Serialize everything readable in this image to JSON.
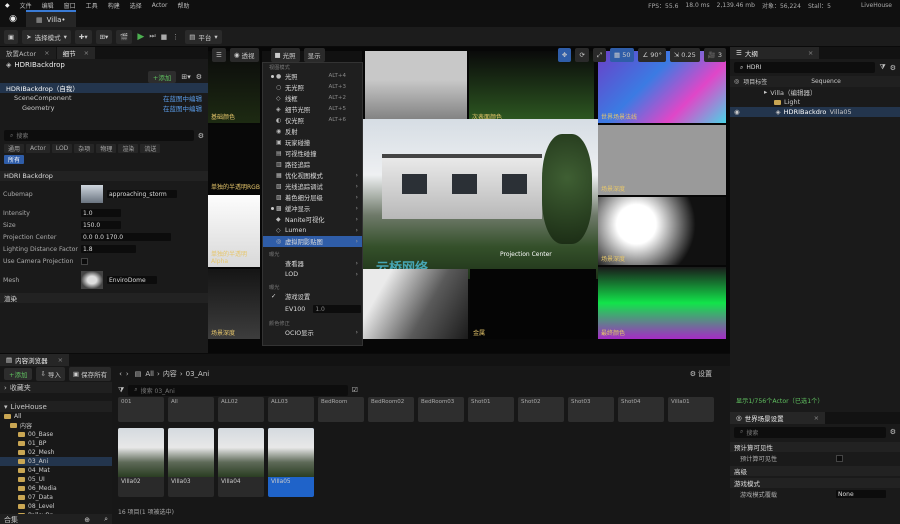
{
  "menubar": {
    "items": [
      "文件",
      "编辑",
      "窗口",
      "工具",
      "构建",
      "选择",
      "Actor",
      "帮助"
    ]
  },
  "stats": {
    "fps": "FPS：55.6",
    "ms": "18.0 ms",
    "mem": "2,139.46 mb",
    "objs": "对象：56,224",
    "stalls": "Stall：5",
    "project": "LiveHouse"
  },
  "tabs": {
    "doc": "Villa•"
  },
  "toolbar": {
    "mode": "选择模式",
    "platform": "平台"
  },
  "left_panel": {
    "tab_place": "放置Actor",
    "tab_details": "细节",
    "actor_name": "HDRIBackdrop",
    "add_label": "+添加",
    "tree": [
      {
        "label": "HDRIBackdrop（自我）",
        "link": ""
      },
      {
        "label": "SceneComponent",
        "link": "在蓝图中编辑"
      },
      {
        "label": "Geometry",
        "link": "在蓝图中编辑"
      }
    ],
    "search_placeholder": "搜索",
    "filters": [
      "通用",
      "Actor",
      "LOD",
      "杂项",
      "物理",
      "渲染",
      "流送"
    ],
    "filter_all": "所有",
    "section": "HDRI Backdrop",
    "props": [
      {
        "label": "Cubemap",
        "value": "approaching_storm"
      },
      {
        "label": "Intensity",
        "value": "1.0"
      },
      {
        "label": "Size",
        "value": "150.0"
      },
      {
        "label": "Projection Center",
        "value": "0.0    0.0    170.0"
      },
      {
        "label": "Lighting Distance Factor",
        "value": "1.8"
      },
      {
        "label": "Use Camera Projection",
        "value": ""
      },
      {
        "label": "Mesh",
        "value": "EnviroDome"
      }
    ],
    "bottom_section": "渲染"
  },
  "viewport": {
    "btn_perspective": "透视",
    "btn_lit": "光照",
    "btn_show": "显示",
    "fov": "90°",
    "speed": "0.25",
    "grid": "50",
    "cam": "3",
    "tiles": [
      "基础颜色",
      "",
      "",
      "次表面颜色",
      "世界场景法线",
      "单独的半透明RGB",
      "",
      "场景深度",
      "单独的半透明Alpha",
      "",
      "",
      "自定义深度",
      "场景深度",
      "",
      "金属",
      "",
      "",
      "高光",
      "最终颜色"
    ],
    "tile_labels": {
      "t1": "基础颜色",
      "t3": "次表面颜色",
      "t4": "世界场景法线",
      "t5": "单独的半透明RGB",
      "t8": "场景深度",
      "t9": "单独的半透明Alpha",
      "t11": "场景深度",
      "t13": "金属",
      "t14": "高光",
      "t15": "最终颜色"
    },
    "projection_center": "Projection Center",
    "watermark": "云桥网络"
  },
  "viewmenu": {
    "header1": "视图模式",
    "items": [
      {
        "label": "光照",
        "key": "ALT+4",
        "icon": "●"
      },
      {
        "label": "无光照",
        "key": "ALT+3",
        "icon": "○"
      },
      {
        "label": "线框",
        "key": "ALT+2",
        "icon": "◇"
      },
      {
        "label": "细节光照",
        "key": "ALT+5",
        "icon": "◈"
      },
      {
        "label": "仅光照",
        "key": "ALT+6",
        "icon": "◐"
      },
      {
        "label": "反射",
        "key": "",
        "icon": "◉"
      },
      {
        "label": "玩家碰撞",
        "key": "",
        "icon": "▣"
      },
      {
        "label": "可视性碰撞",
        "key": "",
        "icon": "▤"
      },
      {
        "label": "路径追踪",
        "key": "",
        "icon": "▥"
      },
      {
        "label": "优化视图模式",
        "key": "",
        "icon": "▦"
      },
      {
        "label": "光线追踪调试",
        "key": "",
        "icon": "▧"
      },
      {
        "label": "着色细分层级",
        "key": "",
        "icon": "▨"
      },
      {
        "label": "缓冲显示",
        "key": "",
        "icon": "▩"
      },
      {
        "label": "Nanite可视化",
        "key": "",
        "icon": "◆"
      },
      {
        "label": "Lumen",
        "key": "",
        "icon": "◇"
      },
      {
        "label": "虚拟阴影贴图",
        "key": "",
        "icon": "◎"
      }
    ],
    "header2": "曝光",
    "items2": [
      {
        "label": "查看器"
      },
      {
        "label": "LOD"
      }
    ],
    "header3": "曝光",
    "game_settings": "游戏设置",
    "ev100_label": "EV100",
    "ev100_value": "1.0",
    "header4": "颜色修正",
    "ocio": "OCIO显示"
  },
  "right_panel": {
    "title": "大纲",
    "search": "HDRI",
    "col_label": "项目标签",
    "col_seq": "Sequence",
    "tree": [
      {
        "label": "Villa（编辑器）",
        "sub": ""
      },
      {
        "label": "Light",
        "sub": ""
      },
      {
        "label": "HDRIBackdro",
        "sub": "Villa05"
      }
    ],
    "status": "显示1/756个Actor（已选1个）",
    "world_settings": "世界场景设置",
    "ws_search": "搜索",
    "ws_rows": [
      {
        "label": "预计算可见性",
        "type": "section"
      },
      {
        "label": "预计算可见性",
        "type": "check"
      },
      {
        "label": "高级",
        "type": "section"
      },
      {
        "label": "游戏模式",
        "type": "section"
      },
      {
        "label": "游戏模式覆载",
        "type": "value",
        "value": "None"
      }
    ]
  },
  "content": {
    "title": "内容浏览器",
    "add": "+添加",
    "import": "导入",
    "save_all": "保存所有",
    "breadcrumb": [
      "All",
      "内容",
      "03_Ani"
    ],
    "settings": "设置",
    "favorites": "收藏夹",
    "project": "LiveHouse",
    "search_placeholder": "搜索 03_Ani",
    "folders": [
      "All",
      "内容",
      "00_Base",
      "01_BP",
      "02_Mesh",
      "03_Ani",
      "04_Mat",
      "05_UI",
      "06_Media",
      "07_Data",
      "08_Level",
      "PolleyBp"
    ],
    "top_assets": [
      "001",
      "All",
      "ALL02",
      "ALL03",
      "BedRoom",
      "BedRoom02",
      "BedRoom03",
      "Shot01",
      "Shot02",
      "Shot03",
      "Shot04",
      "Villa01"
    ],
    "assets": [
      "Villa02",
      "Villa03",
      "Villa04",
      "Villa05"
    ],
    "footer": "16 项目(1 项被选中)",
    "collections": "合集"
  }
}
